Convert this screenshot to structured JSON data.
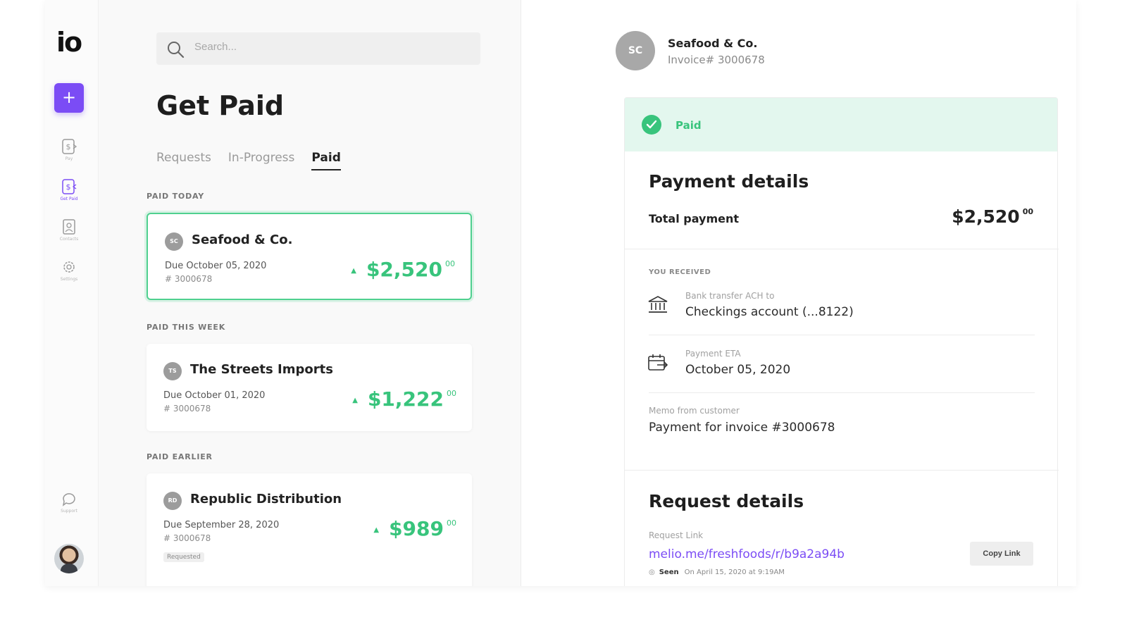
{
  "sidebar": {
    "logo": "iо",
    "add_label": "+",
    "items": [
      {
        "label": "Pay",
        "icon": "pay-dollar-icon"
      },
      {
        "label": "Get Paid",
        "icon": "get-paid-dollar-icon"
      },
      {
        "label": "Contacts",
        "icon": "contacts-icon"
      },
      {
        "label": "Settings",
        "icon": "gear-icon"
      }
    ],
    "support_label": "Support"
  },
  "search": {
    "placeholder": "Search..."
  },
  "page_title": "Get Paid",
  "tabs": [
    {
      "label": "Requests"
    },
    {
      "label": "In-Progress"
    },
    {
      "label": "Paid",
      "active": true
    }
  ],
  "sections": {
    "today": "PAID TODAY",
    "week": "PAID THIS WEEK",
    "earlier": "PAID EARLIER"
  },
  "cards": [
    {
      "initials": "SC",
      "name": "Seafood & Co.",
      "due": "Due October 05, 2020",
      "invoice": "# 3000678",
      "amount": "$2,520",
      "cents": "00"
    },
    {
      "initials": "TS",
      "name": "The Streets Imports",
      "due": "Due October 01, 2020",
      "invoice": "# 3000678",
      "amount": "$1,222",
      "cents": "00"
    },
    {
      "initials": "RD",
      "name": "Republic Distribution",
      "due": "Due September 28, 2020",
      "invoice": "# 3000678",
      "amount": "$989",
      "cents": "00",
      "badge": "Requested"
    }
  ],
  "detail": {
    "initials": "SC",
    "name": "Seafood & Co.",
    "invoice": "Invoice# 3000678",
    "status": "Paid",
    "payment_title": "Payment details",
    "total_label": "Total payment",
    "total_amount": "$2,520",
    "total_cents": "00",
    "received_label": "YOU RECEIVED",
    "bank_sub": "Bank transfer ACH to",
    "bank_val": "Checkings account (...8122)",
    "eta_sub": "Payment ETA",
    "eta_val": "October 05, 2020",
    "memo_sub": "Memo from customer",
    "memo_val": "Payment for invoice #3000678",
    "request_title": "Request details",
    "link_sub": "Request Link",
    "link_val": "melio.me/freshfoods/r/b9a2a94b",
    "copy_label": "Copy Link",
    "seen_label": "Seen",
    "seen_date": "On April 15, 2020 at 9:19AM"
  },
  "colors": {
    "accent": "#7b4cf5",
    "success": "#38c47c",
    "success_bg": "#e3f7ee"
  }
}
